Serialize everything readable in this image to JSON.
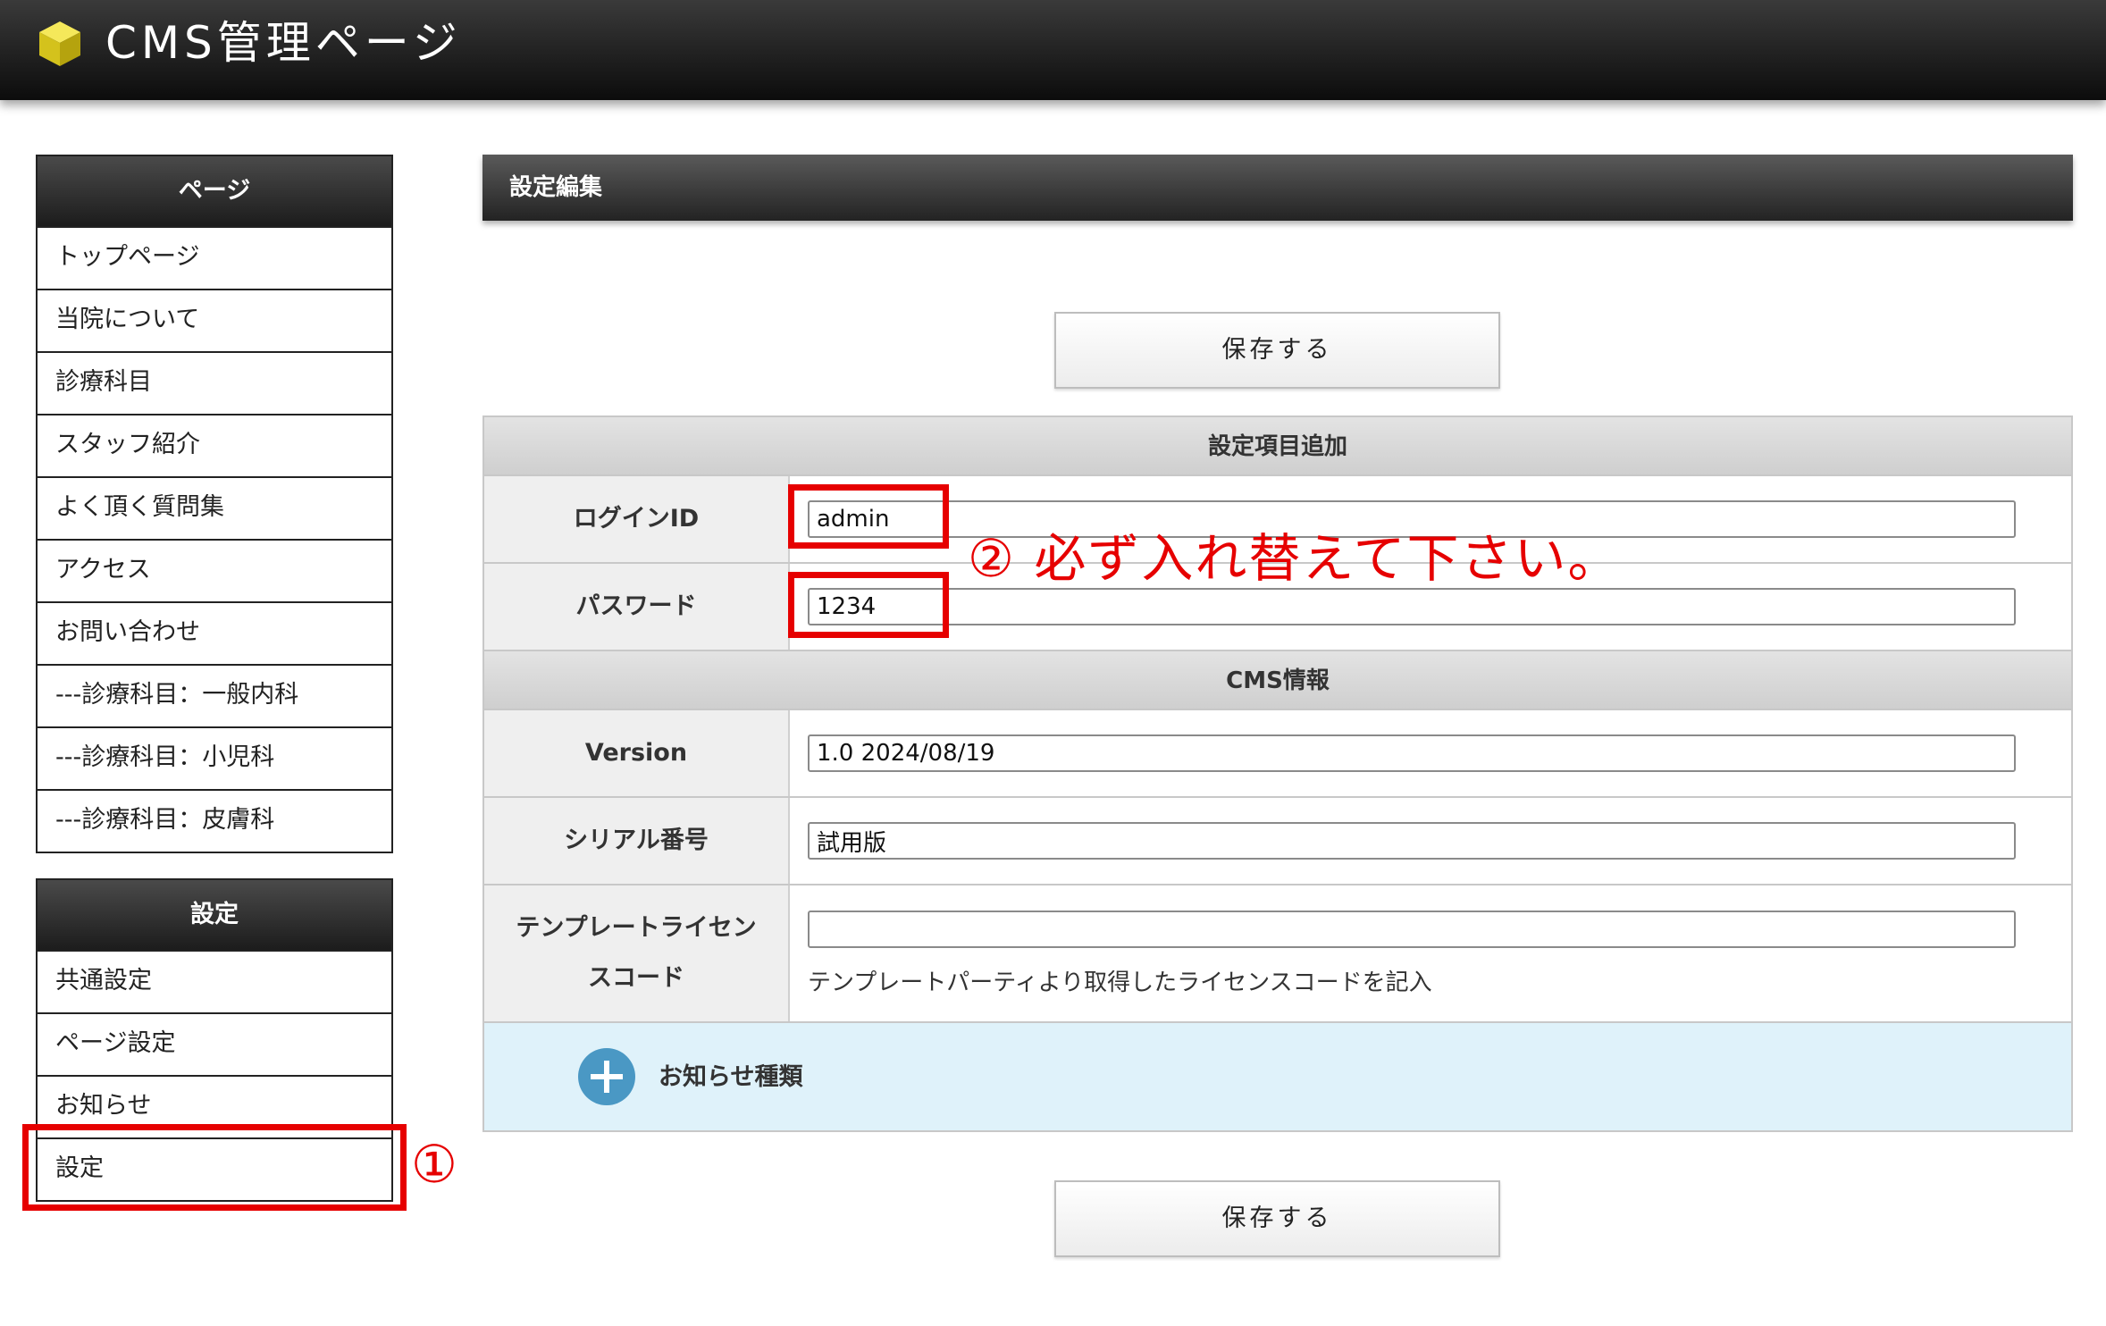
{
  "header": {
    "title": "CMS管理ページ",
    "logo_icon": "yellow-cube-icon"
  },
  "sidebar": {
    "pages": {
      "title": "ページ",
      "items": [
        {
          "label": "トップページ"
        },
        {
          "label": "当院について"
        },
        {
          "label": "診療科目"
        },
        {
          "label": "スタッフ紹介"
        },
        {
          "label": "よく頂く質問集"
        },
        {
          "label": "アクセス"
        },
        {
          "label": "お問い合わせ"
        },
        {
          "label": "---診療科目：一般内科"
        },
        {
          "label": "---診療科目：小児科"
        },
        {
          "label": "---診療科目：皮膚科"
        }
      ]
    },
    "settings": {
      "title": "設定",
      "items": [
        {
          "label": "共通設定"
        },
        {
          "label": "ページ設定"
        },
        {
          "label": "お知らせ"
        },
        {
          "label": "設定"
        }
      ]
    }
  },
  "main": {
    "title": "設定編集",
    "save_label": "保存する",
    "sections": {
      "settings_add": "設定項目追加",
      "cms_info": "CMS情報"
    },
    "fields": {
      "login_id": {
        "label": "ログインID",
        "value": "admin"
      },
      "password": {
        "label": "パスワード",
        "value": "1234"
      },
      "version": {
        "label": "Version",
        "value": "1.0 2024/08/19"
      },
      "serial": {
        "label": "シリアル番号",
        "value": "試用版"
      },
      "template_license": {
        "label_line1": "テンプレートライセン",
        "label_line2": "スコード",
        "value": "",
        "help": "テンプレートパーティより取得したライセンスコードを記入"
      }
    },
    "notice_types": {
      "label": "お知らせ種類",
      "icon": "plus-circle-icon"
    }
  },
  "annotations": {
    "step1": "①",
    "step2": "② 必ず入れ替えて下さい。",
    "color": "#e60000"
  }
}
